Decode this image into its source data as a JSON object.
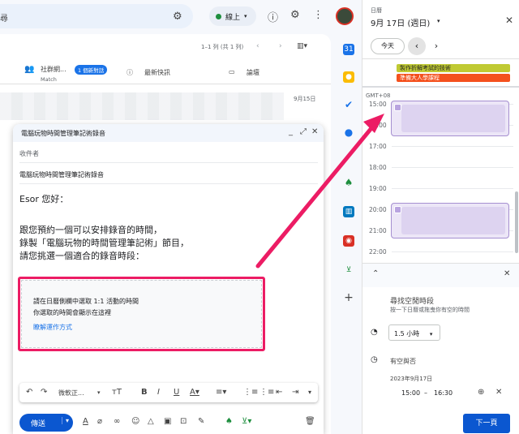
{
  "search": {
    "text": "尋"
  },
  "status": {
    "label": "線上"
  },
  "pager": {
    "range": "1–1 列 (共 1 列)"
  },
  "tabs": {
    "social": {
      "label": "社群網...",
      "badge": "1 個新對話",
      "sub": "Match"
    },
    "updates": {
      "label": "最新快訊"
    },
    "forums": {
      "label": "論壇"
    }
  },
  "mail": {
    "date": "9月15日"
  },
  "compose": {
    "title": "電腦玩物時間管理筆記術錄音",
    "to_placeholder": "收件者",
    "subject": "電腦玩物時間管理筆記術錄音",
    "greeting": "Esor 您好：",
    "line1": "跟您預約一個可以安排錄音的時間，",
    "line2": "錄製「電腦玩物的時間管理筆記術」節目，",
    "line3": "請您挑選一個適合的錄音時段：",
    "sched_line1": "請在日曆側欄中選取 1:1 活動的時間",
    "sched_line2": "你選取的時間會顯示在這裡",
    "sched_link": "瞭解運作方式",
    "font": "微軟正...",
    "send": "傳送"
  },
  "calendar": {
    "label": "日曆",
    "date": "9月 17日 (週日)",
    "today": "今天",
    "events": [
      {
        "title": "製作折解考試的技術",
        "color": "#c0ca33"
      },
      {
        "title": "準備大人學課程",
        "color": "#f4511e"
      }
    ],
    "timezone": "GMT+08",
    "hours": [
      "15:00",
      "16:00",
      "17:00",
      "18:00",
      "19:00",
      "20:00",
      "21:00",
      "22:00"
    ],
    "panel": {
      "title": "尋找空閒時段",
      "subtitle": "按一下日曆或拖曳你有空的時間",
      "duration": "1.5 小時",
      "availability": "有空與否",
      "slot_date": "2023年9月17日",
      "slot_start": "15:00",
      "slot_sep": "–",
      "slot_end": "16:30",
      "next": "下一頁"
    }
  },
  "colors": {
    "accent": "#0b57d0",
    "highlight": "#ec1c64",
    "slot": "#a58fd0"
  }
}
